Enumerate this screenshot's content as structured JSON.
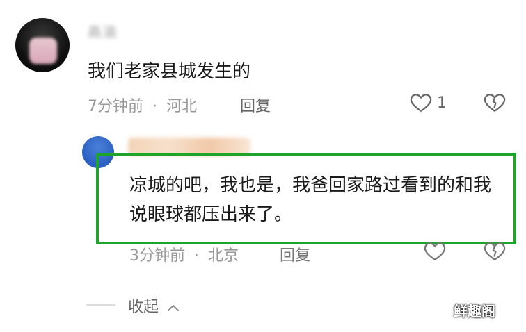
{
  "comment": {
    "username": "高渝",
    "text": "我们老家县城发生的",
    "time": "7分钟前",
    "separator": "·",
    "location": "河北",
    "reply_label": "回复",
    "like_count": "1"
  },
  "reply": {
    "text": "凉城的吧，我也是，我爸回家路过看到的和我说眼球都压出来了。",
    "time": "3分钟前",
    "separator": "·",
    "location": "北京",
    "reply_label": "回复"
  },
  "collapse": {
    "label": "收起",
    "icon": "chevron-up-icon"
  },
  "watermark": "鲜趣阁",
  "colors": {
    "highlight_border": "#1fa32a",
    "meta_text": "#999999",
    "main_text": "#1a1a1a"
  }
}
